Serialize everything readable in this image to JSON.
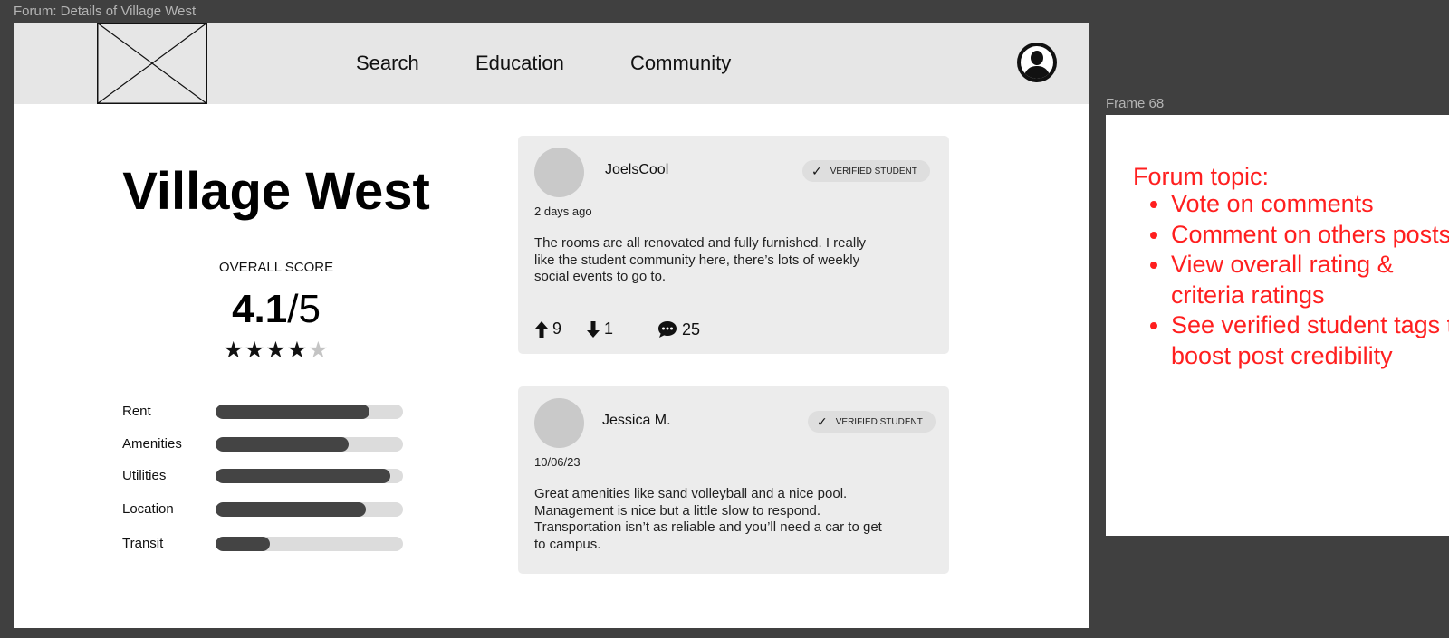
{
  "canvas": {
    "main_frame_label": "Forum: Details of Village West",
    "side_frame_label": "Frame 68",
    "background": "#404040"
  },
  "nav": {
    "logo": "image-placeholder-icon",
    "links": [
      "Search",
      "Education",
      "Community"
    ],
    "profile_icon": "user-profile-icon"
  },
  "property": {
    "title": "Village West",
    "score_label": "OVERALL SCORE",
    "score_value": "4.1",
    "score_max": "/5",
    "stars_filled": 4,
    "stars_total": 5,
    "criteria": [
      {
        "label": "Rent",
        "fraction": 0.82
      },
      {
        "label": "Amenities",
        "fraction": 0.71
      },
      {
        "label": "Utilities",
        "fraction": 0.93
      },
      {
        "label": "Location",
        "fraction": 0.8
      },
      {
        "label": "Transit",
        "fraction": 0.29
      }
    ]
  },
  "posts": [
    {
      "user": "JoelsCool",
      "badge": "VERIFIED STUDENT",
      "date": "2 days ago",
      "body": "The rooms are all renovated and fully furnished. I really like the student community here, there’s lots of weekly social events to go to.",
      "upvotes": "9",
      "downvotes": "1",
      "comments": "25"
    },
    {
      "user": "Jessica M.",
      "badge": "VERIFIED STUDENT",
      "date": "10/06/23",
      "body": "Great amenities like sand volleyball and a nice pool. Management is nice but a little slow to respond. Transportation isn’t as reliable and you’ll need a car to get to campus."
    }
  ],
  "notes": {
    "heading": "Forum topic:",
    "items": [
      "Vote on comments",
      "Comment on others posts",
      "View overall rating & criteria ratings",
      "See verified student tags to boost post credibility"
    ],
    "color": "#ff1f1f"
  }
}
